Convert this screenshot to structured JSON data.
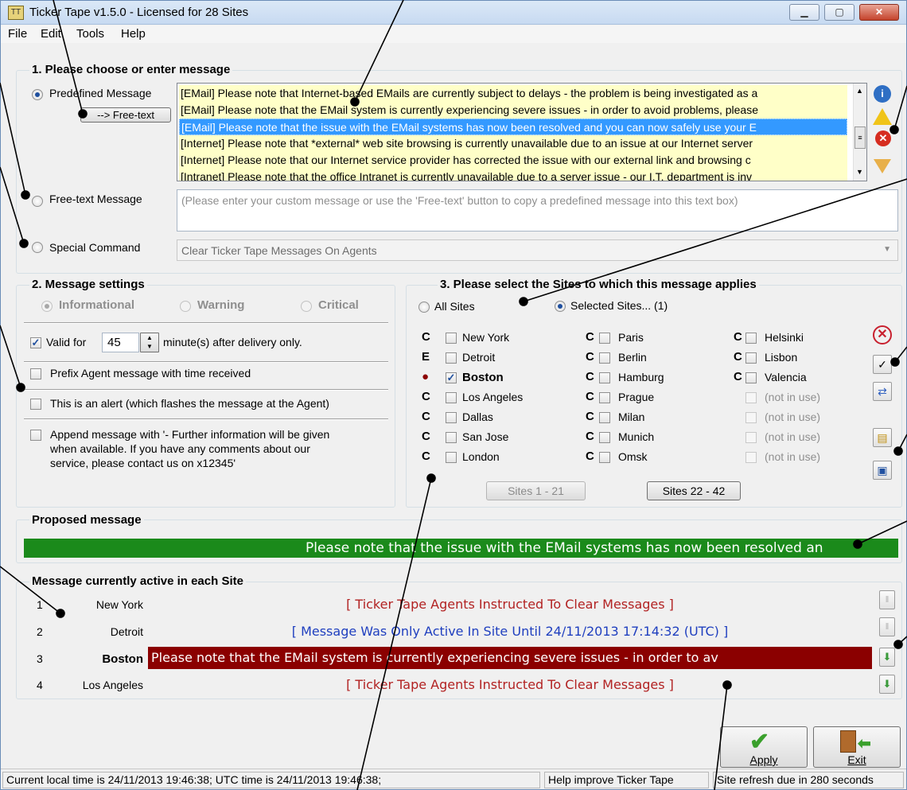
{
  "window": {
    "title": "Ticker Tape v1.5.0 - Licensed for 28 Sites",
    "app_icon": "ticker-tape-icon",
    "controls": [
      "minimize",
      "maximize",
      "close"
    ]
  },
  "menu": [
    "File",
    "Edit",
    "Tools",
    "Help"
  ],
  "section1": {
    "title": "1. Please choose or enter message",
    "predefined_label": "Predefined Message",
    "freetext_button": "--> Free-text",
    "messages": [
      "[EMail] Please note that Internet-based EMails are currently subject to delays - the problem is being investigated as a",
      "[EMail] Please note that the EMail system is currently experiencing severe issues - in order to avoid problems, please",
      "[EMail] Please note that the issue with the EMail systems has now been resolved and you can now safely use your E",
      "[Internet] Please note that *external* web site browsing is currently unavailable due to an issue at our Internet server",
      "[Internet] Please note that our Internet service provider has corrected the issue with our external link and browsing c",
      "[Intranet] Please note that the office Intranet is currently unavailable due to a server issue - our I.T. department is inv"
    ],
    "selected_index": 2,
    "freetext_label": "Free-text Message",
    "freetext_placeholder": "(Please enter your custom message or use the 'Free-text' button to copy a predefined message into this text box)",
    "special_label": "Special Command",
    "special_value": "Clear Ticker Tape Messages On Agents"
  },
  "section2": {
    "title": "2. Message settings",
    "levels": [
      "Informational",
      "Warning",
      "Critical"
    ],
    "valid_for_label": "Valid for",
    "valid_for_value": "45",
    "valid_for_suffix": "minute(s) after delivery only.",
    "prefix_label": "Prefix Agent message with time received",
    "alert_label": "This is an alert (which flashes the message at the Agent)",
    "append_label_1": "Append message with '- Further information will be given",
    "append_label_2": "when available. If you have any comments about our",
    "append_label_3": "service, please contact us on x12345'"
  },
  "section3": {
    "title": "3. Please select the Sites to which this message applies",
    "all_sites": "All Sites",
    "selected_sites": "Selected Sites...  (1)",
    "col1": [
      {
        "code": "C",
        "name": "New York",
        "checked": false
      },
      {
        "code": "E",
        "name": "Detroit",
        "checked": false
      },
      {
        "code": "●",
        "name": "Boston",
        "checked": true
      },
      {
        "code": "C",
        "name": "Los Angeles",
        "checked": false
      },
      {
        "code": "C",
        "name": "Dallas",
        "checked": false
      },
      {
        "code": "C",
        "name": "San Jose",
        "checked": false
      },
      {
        "code": "C",
        "name": "London",
        "checked": false
      }
    ],
    "col2": [
      {
        "code": "C",
        "name": "Paris"
      },
      {
        "code": "C",
        "name": "Berlin"
      },
      {
        "code": "C",
        "name": "Hamburg"
      },
      {
        "code": "C",
        "name": "Prague"
      },
      {
        "code": "C",
        "name": "Milan"
      },
      {
        "code": "C",
        "name": "Munich"
      },
      {
        "code": "C",
        "name": "Omsk"
      }
    ],
    "col3": [
      {
        "code": "C",
        "name": "Helsinki"
      },
      {
        "code": "C",
        "name": "Lisbon"
      },
      {
        "code": "C",
        "name": "Valencia"
      },
      {
        "code": "",
        "name": "(not in use)"
      },
      {
        "code": "",
        "name": "(not in use)"
      },
      {
        "code": "",
        "name": "(not in use)"
      },
      {
        "code": "",
        "name": "(not in use)"
      }
    ],
    "page1": "Sites 1 - 21",
    "page2": "Sites 22 - 42"
  },
  "proposed": {
    "title": "Proposed message",
    "text": "Please note that the issue with the EMail systems has now been resolved an"
  },
  "active": {
    "title": "Message currently active in each Site",
    "rows": [
      {
        "num": "1",
        "site": "New York",
        "msg": "[ Ticker Tape Agents Instructed To Clear Messages ]"
      },
      {
        "num": "2",
        "site": "Detroit",
        "msg": "[ Message Was Only Active In Site Until 24/11/2013 17:14:32 (UTC) ]"
      },
      {
        "num": "3",
        "site": "Boston",
        "msg": "Please note that the EMail system is currently experiencing severe issues - in order to av"
      },
      {
        "num": "4",
        "site": "Los Angeles",
        "msg": "[ Ticker Tape Agents Instructed To Clear Messages ]"
      }
    ]
  },
  "buttons": {
    "apply": "Apply",
    "exit": "Exit"
  },
  "status": {
    "time": "Current local time is 24/11/2013 19:46:38;  UTC time is 24/11/2013 19:46:38;",
    "help": "Help improve Ticker Tape",
    "refresh": "Site refresh due in 280 seconds"
  },
  "colors": {
    "selection": "#3399ff",
    "list_bg": "#ffffc8",
    "banner_green": "#1b8a1b",
    "alert_red": "#8b0000",
    "msg_red": "#b22222",
    "msg_blue": "#1f3fbf"
  }
}
